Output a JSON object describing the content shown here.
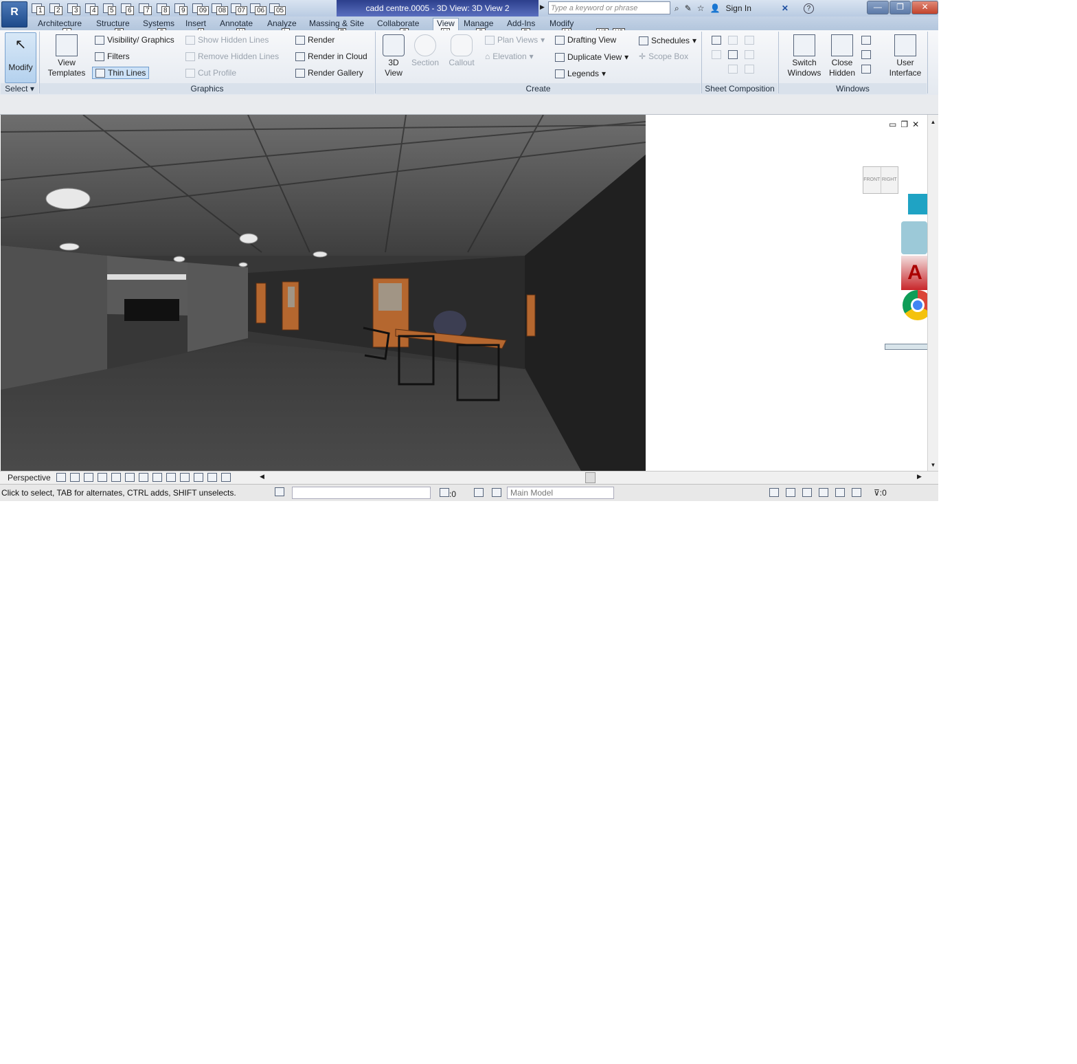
{
  "app": {
    "logo_letter": "R",
    "window_title": "cadd centre.0005 - 3D View: 3D View 2",
    "search_placeholder": "Type a keyword or phrase",
    "sign_in": "Sign In",
    "help": "?"
  },
  "qat_keytips": [
    "1",
    "2",
    "3",
    "4",
    "5",
    "6",
    "7",
    "8",
    "9",
    "09",
    "08",
    "07",
    "06",
    "05"
  ],
  "tabs": [
    {
      "label": "Architecture",
      "key": "A"
    },
    {
      "label": "Structure",
      "key": "R"
    },
    {
      "label": "Systems",
      "key": "S"
    },
    {
      "label": "Insert",
      "key": "I"
    },
    {
      "label": "Annotate",
      "key": "N"
    },
    {
      "label": "Analyze",
      "key": "L"
    },
    {
      "label": "Massing & Site",
      "key": "T"
    },
    {
      "label": "Collaborate",
      "key": "C"
    },
    {
      "label": "View",
      "key": "V"
    },
    {
      "label": "Manage",
      "key": "G"
    },
    {
      "label": "Add-Ins",
      "key": "D"
    },
    {
      "label": "Modify",
      "key": "M"
    }
  ],
  "extra_keytips": [
    "X2",
    "X3"
  ],
  "ribbon": {
    "modify": "Modify",
    "view_templates": [
      "View",
      "Templates"
    ],
    "visibility": "Visibility/  Graphics",
    "filters": "Filters",
    "thin_lines": "Thin  Lines",
    "show_hidden": "Show  Hidden  Lines",
    "remove_hidden": "Remove  Hidden  Lines",
    "cut_profile": "Cut  Profile",
    "render": "Render",
    "render_cloud": "Render  in  Cloud",
    "render_gallery": "Render  Gallery",
    "view3d": [
      "3D",
      "View"
    ],
    "section": "Section",
    "callout": "Callout",
    "plan_views": "Plan  Views",
    "elevation": "Elevation",
    "drafting_view": "Drafting  View",
    "duplicate_view": "Duplicate  View",
    "legends": "Legends",
    "schedules": "Schedules",
    "scope_box": "Scope  Box",
    "switch_windows": [
      "Switch",
      "Windows"
    ],
    "close_hidden": [
      "Close",
      "Hidden"
    ],
    "user_interface": [
      "User",
      "Interface"
    ]
  },
  "panels": {
    "select": "Select",
    "graphics": "Graphics",
    "create": "Create",
    "sheet_composition": "Sheet Composition",
    "windows": "Windows"
  },
  "viewcube": {
    "front": "FRONT",
    "right": "RIGHT"
  },
  "view_control": {
    "mode": "Perspective"
  },
  "status": {
    "message": "Click to select, TAB for alternates, CTRL adds, SHIFT unselects.",
    "sel_count": ":0",
    "model": "Main Model",
    "filter_count": ":0"
  },
  "colors": {
    "accent": "#2c3f8c",
    "ribbon_bg": "#e4e9f0",
    "viewport_bg": "#2e2e2e",
    "wood": "#b5672f"
  },
  "icons": [
    "search-icon",
    "star-icon",
    "user-icon",
    "help-icon",
    "close-icon",
    "chrome-icon",
    "autocad-icon"
  ]
}
